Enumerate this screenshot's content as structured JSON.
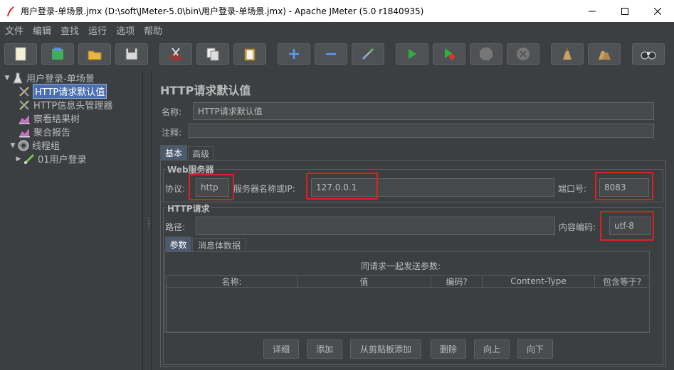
{
  "window": {
    "title": "用户登录-单场景.jmx (D:\\soft\\JMeter-5.0\\bin\\用户登录-单场景.jmx) - Apache JMeter (5.0 r1840935)"
  },
  "menu": [
    "文件",
    "编辑",
    "查找",
    "运行",
    "选项",
    "帮助"
  ],
  "toolbar": {
    "icons": [
      "new-icon",
      "templates-icon",
      "open-icon",
      "save-icon",
      "cut-icon",
      "copy-icon",
      "paste-icon",
      "expand-icon",
      "collapse-icon",
      "toggle-icon",
      "start-icon",
      "start-no-pause-icon",
      "stop-icon",
      "shutdown-icon",
      "clear-icon",
      "clear-all-icon",
      "search-icon"
    ]
  },
  "tree": {
    "root": "用户登录-单场景",
    "items": [
      {
        "label": "HTTP请求默认值",
        "icon": "config-icon"
      },
      {
        "label": "HTTP信息头管理器",
        "icon": "config-icon"
      },
      {
        "label": "察看结果树",
        "icon": "listener-icon"
      },
      {
        "label": "聚合报告",
        "icon": "listener-icon"
      },
      {
        "label": "线程组",
        "icon": "thread-group-icon"
      },
      {
        "label": "01用户登录",
        "icon": "sampler-icon"
      }
    ]
  },
  "panel": {
    "title": "HTTP请求默认值",
    "name_label": "名称:",
    "name_value": "HTTP请求默认值",
    "comment_label": "注释:",
    "comment_value": "",
    "tabs": [
      "基本",
      "高级"
    ],
    "web_server": {
      "title": "Web服务器",
      "protocol_label": "协议:",
      "protocol_value": "http",
      "server_label": "服务器名称或IP:",
      "server_value": "127.0.0.1",
      "port_label": "端口号:",
      "port_value": "8083"
    },
    "http_request": {
      "title": "HTTP请求",
      "path_label": "路径:",
      "path_value": "",
      "encoding_label": "内容编码:",
      "encoding_value": "utf-8"
    },
    "sub_tabs": [
      "参数",
      "消息体数据"
    ],
    "params_caption": "同请求一起发送参数:",
    "columns": [
      "名称:",
      "值",
      "编码?",
      "Content-Type",
      "包含等于?"
    ],
    "buttons": [
      "详细",
      "添加",
      "从剪贴板添加",
      "删除",
      "向上",
      "向下"
    ]
  },
  "colors": {
    "background": "#3c3f41",
    "selection": "#4b6eaf",
    "highlight": "#e02020"
  }
}
